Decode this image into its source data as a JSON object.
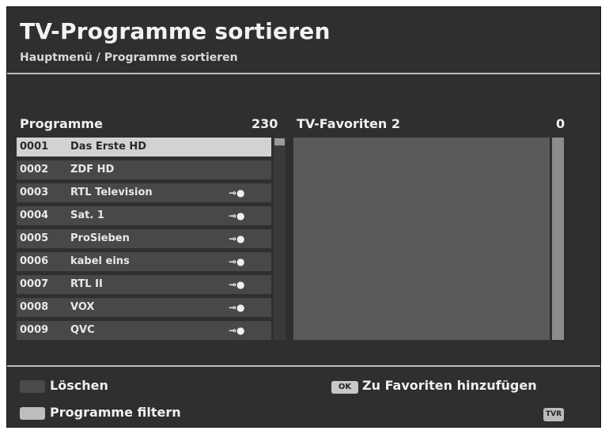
{
  "header": {
    "title": "TV-Programme sortieren",
    "breadcrumb": "Hauptmenü / Programme sortieren"
  },
  "left_list": {
    "title": "Programme",
    "count": "230",
    "rows": [
      {
        "num": "0001",
        "name": "Das Erste HD",
        "key": ""
      },
      {
        "num": "0002",
        "name": "ZDF HD",
        "key": ""
      },
      {
        "num": "0003",
        "name": "RTL Television",
        "key": "key-icon"
      },
      {
        "num": "0004",
        "name": "Sat. 1",
        "key": "key-icon"
      },
      {
        "num": "0005",
        "name": "ProSieben",
        "key": "key-icon"
      },
      {
        "num": "0006",
        "name": "kabel eins",
        "key": "key-icon"
      },
      {
        "num": "0007",
        "name": "RTL II",
        "key": "key-icon"
      },
      {
        "num": "0008",
        "name": "VOX",
        "key": "key-icon"
      },
      {
        "num": "0009",
        "name": "QVC",
        "key": "key-icon"
      }
    ],
    "selected_index": 0
  },
  "right_list": {
    "title": "TV-Favoriten 2",
    "count": "0"
  },
  "footer": {
    "delete_label": "Löschen",
    "filter_label": "Programme filtern",
    "ok_key": "OK",
    "add_fav_label": "Zu Favoriten hinzufügen",
    "tvr_key": "TVR"
  },
  "colors": {
    "background": "#2f2f2f",
    "selected_row": "#d2d2d2",
    "row": "#484848"
  }
}
